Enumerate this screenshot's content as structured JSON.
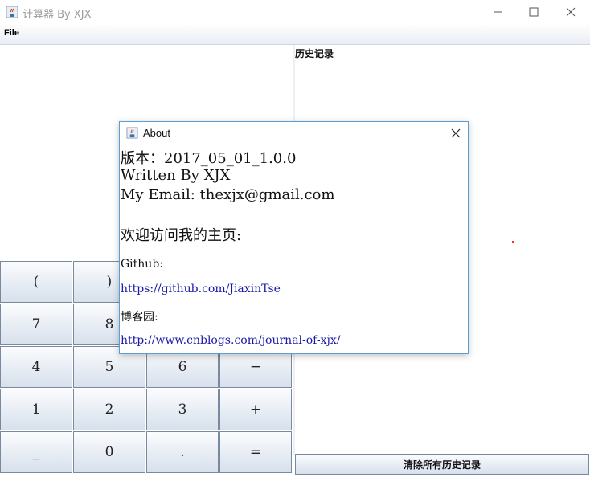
{
  "window": {
    "title": "计算器 By XJX"
  },
  "menu": {
    "file": "File"
  },
  "history": {
    "title": "历史记录",
    "clear_button": "清除所有历史记录"
  },
  "keypad": {
    "rows": [
      [
        "(",
        ")",
        "",
        ""
      ],
      [
        "7",
        "8",
        "",
        ""
      ],
      [
        "4",
        "5",
        "6",
        "−"
      ],
      [
        "1",
        "2",
        "3",
        "+"
      ],
      [
        "_",
        "0",
        ".",
        "="
      ]
    ]
  },
  "about": {
    "title": "About",
    "version": "版本：2017_05_01_1.0.0",
    "written_by": "Written By XJX",
    "email": "My Email: thexjx@gmail.com",
    "welcome": "欢迎访问我的主页:",
    "github_label": "Github:",
    "github_url": "https://github.com/JiaxinTse",
    "blog_label": "博客园:",
    "blog_url": "http://www.cnblogs.com/journal-of-xjx/"
  },
  "icons": {
    "app": "java-coffee-icon",
    "minimize": "minimize-icon",
    "maximize": "maximize-icon",
    "close": "close-icon"
  }
}
